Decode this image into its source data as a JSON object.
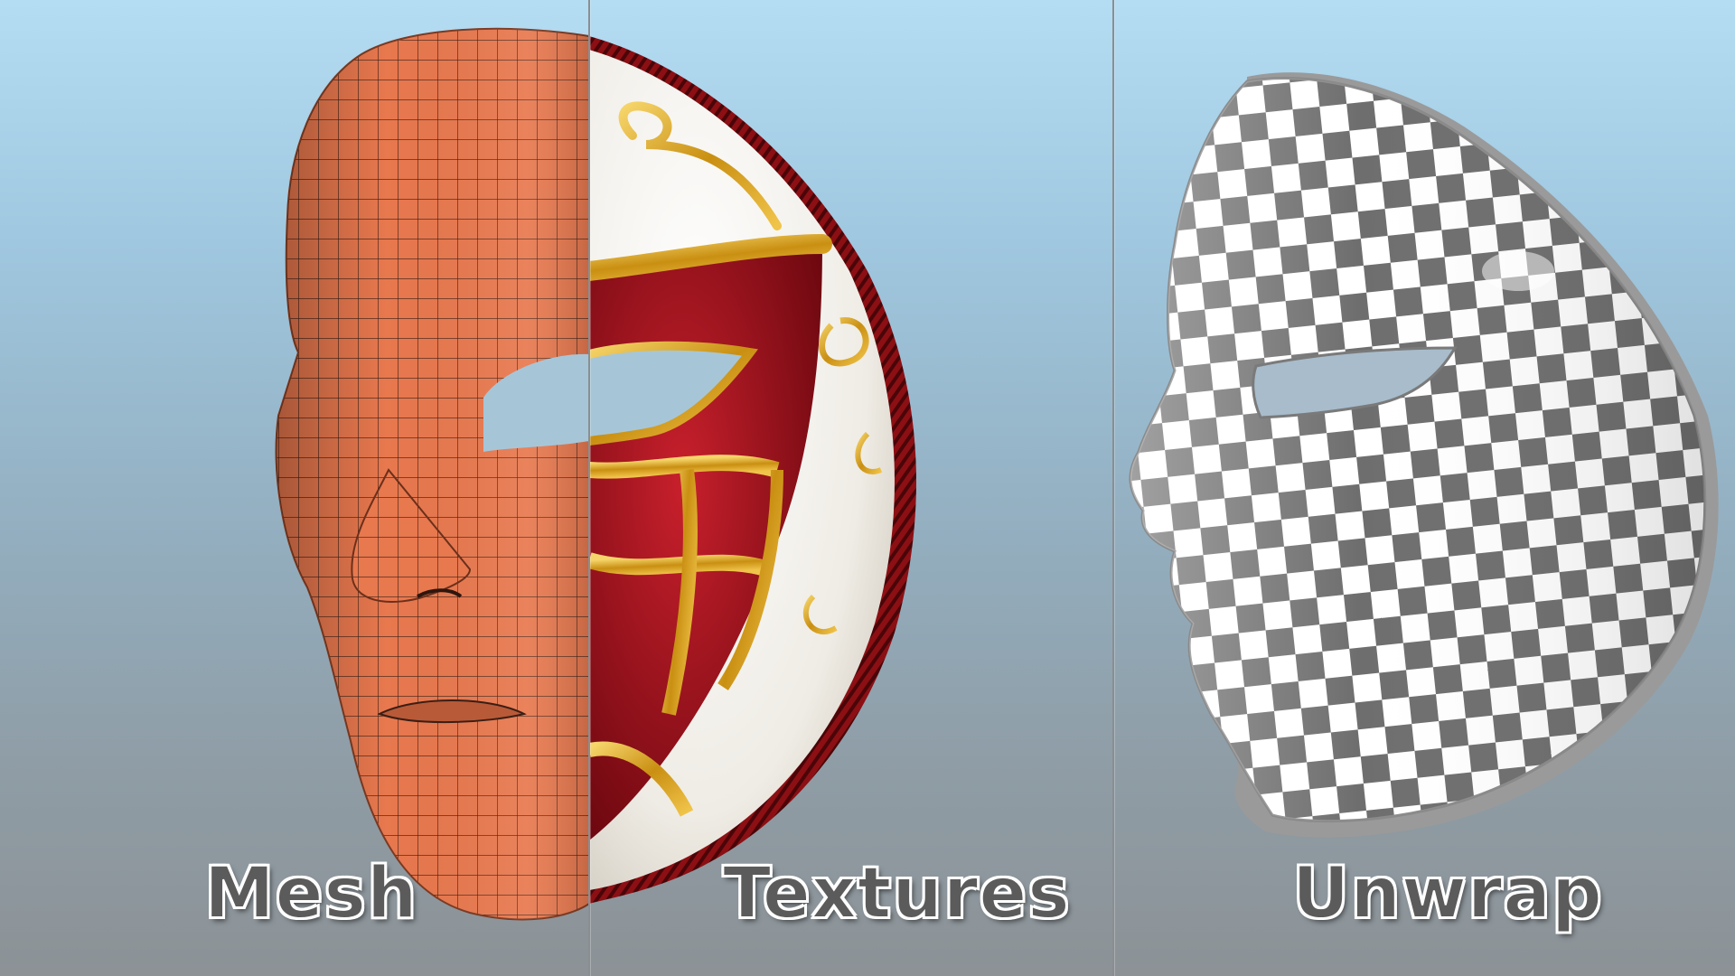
{
  "captions": {
    "mesh": "Mesh",
    "textures": "Textures",
    "unwrap": "Unwrap"
  },
  "colors": {
    "mesh_skin": "#e8784e",
    "wire": "#3a1e14",
    "gold": "#d6a21c",
    "crimson": "#a4101c",
    "porcelain": "#f2f0ea",
    "checker_dark": "#6e6e6e",
    "checker_light": "#ffffff"
  }
}
